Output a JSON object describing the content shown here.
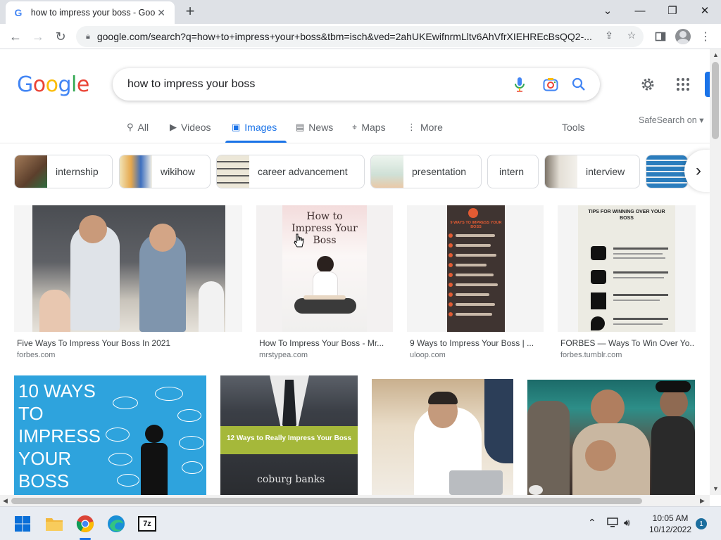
{
  "browser": {
    "tab_title": "how to impress your boss - Goog",
    "favicon": "G",
    "url": "google.com/search?q=how+to+impress+your+boss&tbm=isch&ved=2ahUKEwifnrmLltv6AhVfrXIEHREcBsQQ2-..."
  },
  "google": {
    "logo_letters": [
      {
        "ch": "G",
        "color": "#4285f4"
      },
      {
        "ch": "o",
        "color": "#ea4335"
      },
      {
        "ch": "o",
        "color": "#fbbc05"
      },
      {
        "ch": "g",
        "color": "#4285f4"
      },
      {
        "ch": "l",
        "color": "#34a853"
      },
      {
        "ch": "e",
        "color": "#ea4335"
      }
    ],
    "query": "how to impress your boss",
    "tabs": [
      {
        "label": "All",
        "icon": "search-icon"
      },
      {
        "label": "Videos",
        "icon": "video-icon"
      },
      {
        "label": "Images",
        "icon": "image-icon",
        "active": true
      },
      {
        "label": "News",
        "icon": "news-icon"
      },
      {
        "label": "Maps",
        "icon": "map-pin-icon"
      },
      {
        "label": "More",
        "icon": "more-vert-icon"
      }
    ],
    "tools_label": "Tools",
    "safesearch_label": "SafeSearch on"
  },
  "chips": [
    {
      "label": "internship",
      "thumb_color": "#7a5a40"
    },
    {
      "label": "wikihow",
      "thumb_color": "#e8c27a"
    },
    {
      "label": "career advancement",
      "thumb_color": "#d8d2c0"
    },
    {
      "label": "presentation",
      "thumb_color": "#cfe0d6"
    },
    {
      "label": "intern",
      "thumb_color": ""
    },
    {
      "label": "interview",
      "thumb_color": "#b9b2a6"
    },
    {
      "label": "",
      "thumb_color": "#2b7dbd"
    }
  ],
  "results": [
    {
      "title": "Five Ways To Impress Your Boss In 2021",
      "site": "forbes.com"
    },
    {
      "title": "How To Impress Your Boss - Mr...",
      "site": "mrstypea.com",
      "image_text": "How to Impress Your Boss"
    },
    {
      "title": "9 Ways to Impress Your Boss | ...",
      "site": "uloop.com",
      "image_text": "9 WAYS TO IMPRESS YOUR BOSS"
    },
    {
      "title": "FORBES — Ways To Win Over Yo...",
      "site": "forbes.tumblr.com",
      "image_text": "TIPS FOR WINNING OVER YOUR BOSS"
    },
    {
      "image_text": "10 WAYS TO IMPRESS YOUR BOSS"
    },
    {
      "image_text": "12 Ways to Really Impress Your Boss",
      "image_brand": "coburg banks"
    },
    {},
    {}
  ],
  "taskbar": {
    "time": "10:05 AM",
    "date": "10/12/2022",
    "notifications": "1"
  },
  "colors": {
    "accent": "#1a73e8",
    "taskbar": "#e8ecf2"
  }
}
